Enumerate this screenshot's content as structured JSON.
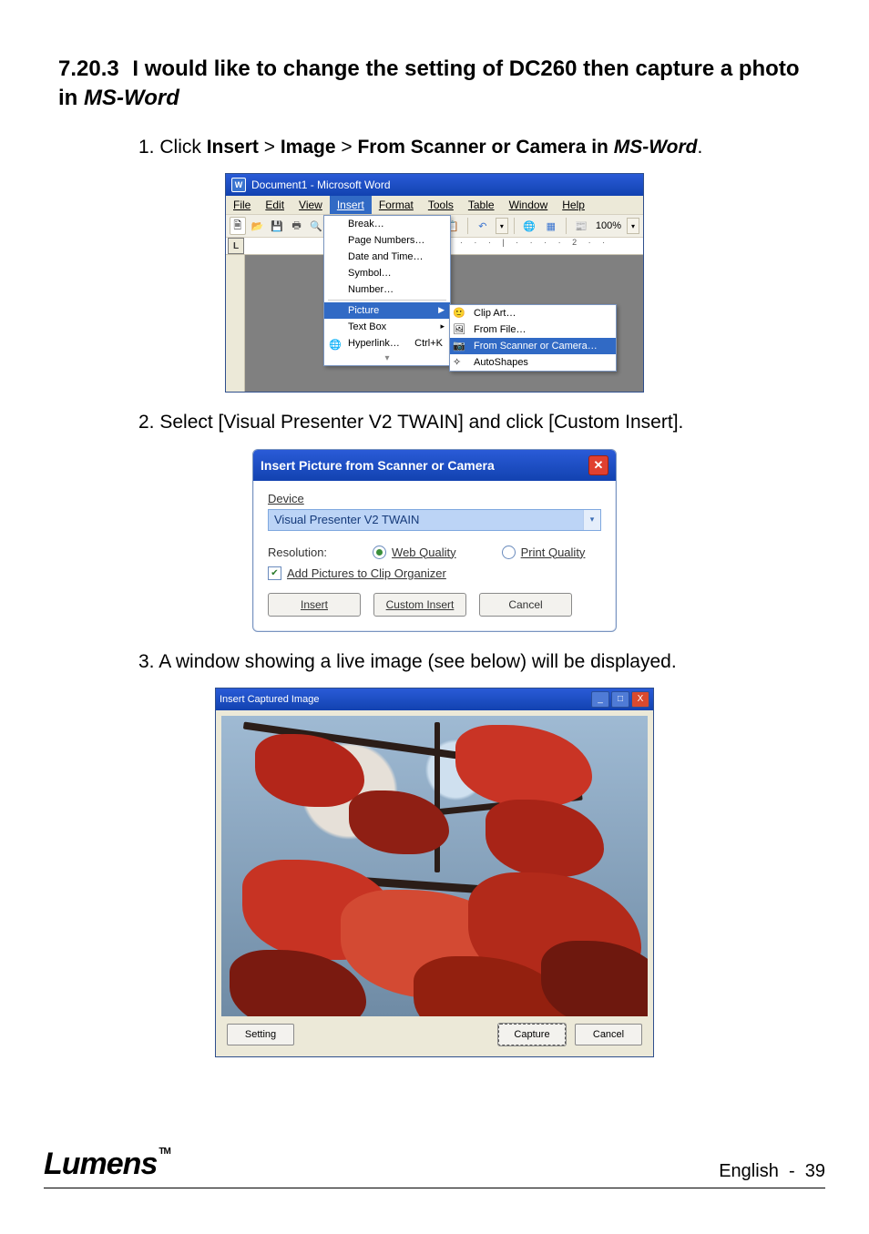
{
  "heading": {
    "number": "7.20.3",
    "text_prefix": "I would like to change the setting of DC260 then capture a photo in ",
    "text_em": "MS-Word"
  },
  "steps": {
    "s1": {
      "num": "1.",
      "pre": "Click ",
      "b1": "Insert",
      "gt1": " > ",
      "b2": "Image",
      "gt2": " > ",
      "b3": "From Scanner or Camera in ",
      "em": "MS-Word",
      "post": "."
    },
    "s2": {
      "num": "2.",
      "text": "Select [Visual Presenter V2 TWAIN] and click [Custom Insert]."
    },
    "s3": {
      "num": "3.",
      "text": "A window showing a live image (see below) will be displayed."
    }
  },
  "word": {
    "title": "Document1 - Microsoft Word",
    "menus": {
      "file": "File",
      "edit": "Edit",
      "view": "View",
      "insert": "Insert",
      "format": "Format",
      "tools": "Tools",
      "table": "Table",
      "window": "Window",
      "help": "Help"
    },
    "zoom": "100%",
    "tab_indicator": "L",
    "ruler_marks": "· · | · · · · 1 · · · · | · · · · 2 · ·",
    "insert_menu": {
      "break": "Break…",
      "page_numbers": "Page Numbers…",
      "date_time": "Date and Time…",
      "symbol": "Symbol…",
      "number": "Number…",
      "picture": "Picture",
      "textbox": "Text Box",
      "hyperlink": "Hyperlink…",
      "hyperlink_sc": "Ctrl+K",
      "expand": "▾"
    },
    "picture_sub": {
      "clipart": "Clip Art…",
      "fromfile": "From File…",
      "scanner": "From Scanner or Camera…",
      "autoshapes": "AutoShapes"
    }
  },
  "dialog": {
    "title": "Insert Picture from Scanner or Camera",
    "device_label": "Device",
    "device_value": "Visual Presenter V2 TWAIN",
    "resolution_label": "Resolution:",
    "web_quality": "Web Quality",
    "print_quality": "Print Quality",
    "add_clip": "Add Pictures to Clip Organizer",
    "btn_insert": "Insert",
    "btn_custom": "Custom Insert",
    "btn_cancel": "Cancel"
  },
  "capture": {
    "title": "Insert Captured Image",
    "btn_setting": "Setting",
    "btn_capture": "Capture",
    "btn_cancel": "Cancel",
    "win_min": "_",
    "win_max": "□",
    "win_close": "X"
  },
  "footer": {
    "logo": "Lumens",
    "tm": "TM",
    "lang": "English",
    "sep": "-",
    "page": "39"
  }
}
